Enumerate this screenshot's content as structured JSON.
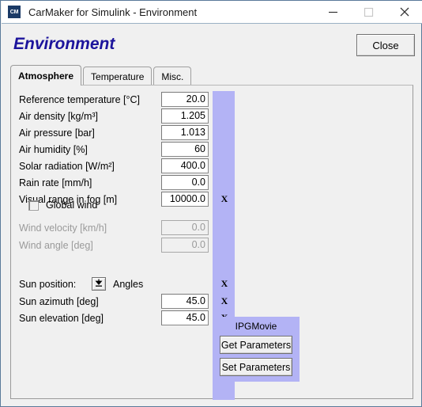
{
  "window": {
    "title": "CarMaker for Simulink - Environment",
    "icon_label": "CM",
    "icon_name": "carmaker-app-icon",
    "controls": {
      "minimize": "minimize-icon",
      "maximize": "maximize-icon",
      "close": "close-icon"
    }
  },
  "header": {
    "title": "Environment",
    "title_color": "#1c149c",
    "close_label": "Close"
  },
  "tabs": [
    {
      "label": "Atmosphere",
      "active": true
    },
    {
      "label": "Temperature",
      "active": false
    },
    {
      "label": "Misc.",
      "active": false
    }
  ],
  "strip": {
    "color": "#b3b3f5",
    "marker": "X"
  },
  "form": {
    "rows": [
      {
        "label": "Reference temperature [°C]",
        "value": "20.0",
        "disabled": false,
        "marker": ""
      },
      {
        "label": "Air density [kg/m³]",
        "value": "1.205",
        "disabled": false,
        "marker": ""
      },
      {
        "label": "Air pressure [bar]",
        "value": "1.013",
        "disabled": false,
        "marker": ""
      },
      {
        "label": "Air humidity [%]",
        "value": "60",
        "disabled": false,
        "marker": ""
      },
      {
        "label": "Solar radiation [W/m²]",
        "value": "400.0",
        "disabled": false,
        "marker": ""
      },
      {
        "label": "Rain rate [mm/h]",
        "value": "0.0",
        "disabled": false,
        "marker": ""
      },
      {
        "label": "Visual range in fog [m]",
        "value": "10000.0",
        "disabled": false,
        "marker": "X"
      }
    ],
    "global_wind": {
      "label": "Global wind",
      "checked": false
    },
    "wind_rows": [
      {
        "label": "Wind velocity [km/h]",
        "value": "0.0",
        "disabled": true,
        "marker": ""
      },
      {
        "label": "Wind angle [deg]",
        "value": "0.0",
        "disabled": true,
        "marker": ""
      }
    ],
    "sun_position": {
      "label": "Sun position:",
      "value": "Angles",
      "marker": "X"
    },
    "sun_rows": [
      {
        "label": "Sun azimuth [deg]",
        "value": "45.0",
        "disabled": false,
        "marker": "X"
      },
      {
        "label": "Sun elevation [deg]",
        "value": "45.0",
        "disabled": false,
        "marker": "X"
      }
    ]
  },
  "ipgmovie": {
    "title": "IPGMovie",
    "get_label": "Get Parameters",
    "set_label": "Set Parameters"
  }
}
